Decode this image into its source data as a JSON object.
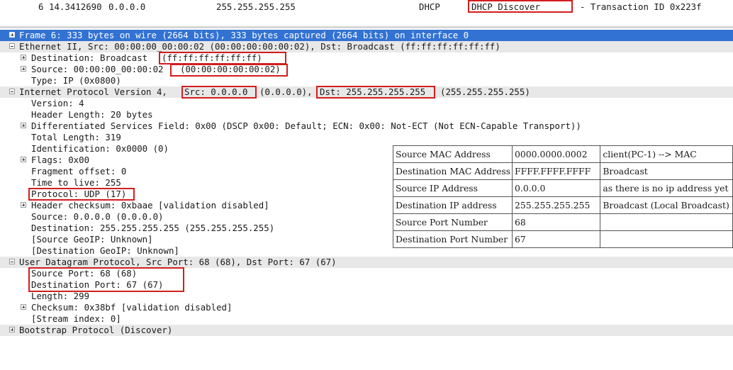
{
  "packet_row": {
    "no": "6",
    "time": "14.3412690",
    "source": "0.0.0.0",
    "destination": "255.255.255.255",
    "protocol": "DHCP",
    "length": "333",
    "info_main": "DHCP Discover",
    "info_rest": "- Transaction ID 0x223f"
  },
  "tree": {
    "frame": "Frame 6: 333 bytes on wire (2664 bits), 333 bytes captured (2664 bits) on interface 0",
    "eth": "Ethernet II, Src: 00:00:00_00:00:02 (00:00:00:00:00:02), Dst: Broadcast (ff:ff:ff:ff:ff:ff)",
    "eth_dst_a": "Destination: Broadcast",
    "eth_dst_b": "(ff:ff:ff:ff:ff:ff)",
    "eth_src_a": "Source: 00:00:00_00:00:02",
    "eth_src_b": "(00:00:00:00:00:02)",
    "eth_type": "Type: IP (0x0800)",
    "ip_a": "Internet Protocol Version 4,",
    "ip_src": "Src: 0.0.0.0",
    "ip_mid": "(0.0.0.0),",
    "ip_dst": "Dst: 255.255.255.255",
    "ip_end": "(255.255.255.255)",
    "ip_version": "Version: 4",
    "ip_hlen": "Header Length: 20 bytes",
    "ip_dsf": "Differentiated Services Field: 0x00 (DSCP 0x00: Default; ECN: 0x00: Not-ECT (Not ECN-Capable Transport))",
    "ip_total": "Total Length: 319",
    "ip_id": "Identification: 0x0000 (0)",
    "ip_flags": "Flags: 0x00",
    "ip_frag": "Fragment offset: 0",
    "ip_ttl": "Time to live: 255",
    "ip_proto": "Protocol: UDP (17)",
    "ip_cksum": "Header checksum: 0xbaae [validation disabled]",
    "ip_source": "Source: 0.0.0.0 (0.0.0.0)",
    "ip_dest": "Destination: 255.255.255.255 (255.255.255.255)",
    "ip_srcgeo": "[Source GeoIP: Unknown]",
    "ip_dstgeo": "[Destination GeoIP: Unknown]",
    "udp": "User Datagram Protocol, Src Port: 68 (68), Dst Port: 67 (67)",
    "udp_sport": "Source Port: 68 (68)",
    "udp_dport": "Destination Port: 67 (67)",
    "udp_len": "Length: 299",
    "udp_cksum": "Checksum: 0x38bf [validation disabled]",
    "udp_stream": "[Stream index: 0]",
    "bootp": "Bootstrap Protocol (Discover)"
  },
  "info_table": [
    [
      "Source MAC Address",
      "0000.0000.0002",
      "client(PC-1) --> MAC"
    ],
    [
      "Destination MAC Address",
      "FFFF.FFFF.FFFF",
      "Broadcast"
    ],
    [
      "Source IP Address",
      "0.0.0.0",
      "as there is no ip address yet"
    ],
    [
      "Destination IP address",
      "255.255.255.255",
      "Broadcast (Local Broadcast)"
    ],
    [
      "Source Port Number",
      "68",
      ""
    ],
    [
      "Destination Port Number",
      "67",
      ""
    ]
  ]
}
